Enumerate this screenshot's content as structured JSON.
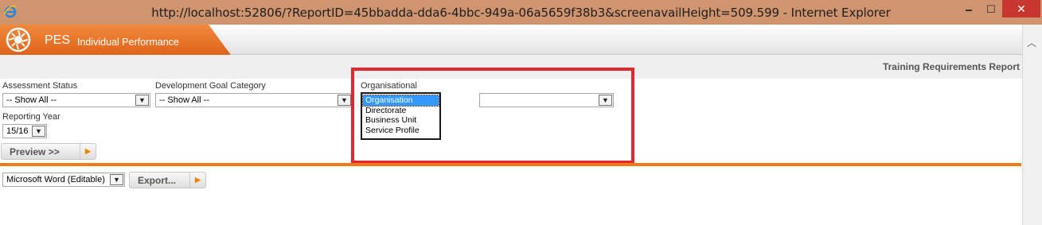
{
  "window": {
    "title": "http://localhost:52806/?ReportID=45bbadda-dda6-4bbc-949a-06a5659f38b3&screenavailHeight=509.599 - Internet Explorer",
    "minimize": "🗕",
    "maximize": "☐",
    "close": "✕"
  },
  "header": {
    "brand": "PES",
    "subtitle": "Individual Performance",
    "report_title": "Training Requirements Report"
  },
  "filters": {
    "assessment_status": {
      "label": "Assessment Status",
      "value": "-- Show All --"
    },
    "development_goal_category": {
      "label": "Development Goal Category",
      "value": "-- Show All --"
    },
    "organisational": {
      "label": "Organisational",
      "options": [
        "Organisation",
        "Directorate",
        "Business Unit",
        "Service Profile"
      ],
      "selected": "Organisation",
      "second_select_value": ""
    },
    "reporting_year": {
      "label": "Reporting Year",
      "value": "15/16"
    }
  },
  "actions": {
    "preview_label": "Preview >>",
    "export_format": "Microsoft Word (Editable)",
    "export_label": "Export..."
  },
  "colors": {
    "brand_orange": "#e8742a",
    "highlight_red": "#e0282e",
    "selection_blue": "#3399ff"
  }
}
